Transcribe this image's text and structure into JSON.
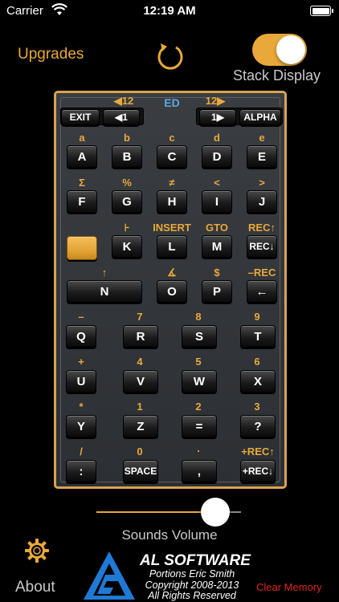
{
  "status": {
    "carrier": "Carrier",
    "time": "12:19 AM"
  },
  "top": {
    "upgrades": "Upgrades",
    "stack_display": "Stack Display",
    "stack_display_on": true
  },
  "calc": {
    "row0": {
      "left_arrow_label": "◀12",
      "ed_label": "ED",
      "right_arrow_label": "12▶",
      "exit": "EXIT",
      "back1": "◀1",
      "fwd1": "1▶",
      "alpha": "ALPHA"
    },
    "rows": [
      {
        "labels": [
          "a",
          "b",
          "c",
          "d",
          "e"
        ],
        "keys": [
          "A",
          "B",
          "C",
          "D",
          "E"
        ]
      },
      {
        "labels": [
          "Σ",
          "%",
          "≠",
          "<",
          ">"
        ],
        "keys": [
          "F",
          "G",
          "H",
          "I",
          "J"
        ]
      },
      {
        "labels": [
          "",
          "⊦",
          "INSERT",
          "GTO",
          "REC↑"
        ],
        "keys": [
          "",
          "K",
          "L",
          "M",
          "REC↓"
        ]
      },
      {
        "labels": [
          "↑",
          "",
          "∡",
          "$",
          "–REC"
        ],
        "keys": [
          "N",
          "",
          "O",
          "P",
          "←"
        ]
      },
      {
        "labels": [
          "–",
          "7",
          "8",
          "9"
        ],
        "keys": [
          "Q",
          "R",
          "S",
          "T"
        ]
      },
      {
        "labels": [
          "+",
          "4",
          "5",
          "6"
        ],
        "keys": [
          "U",
          "V",
          "W",
          "X"
        ]
      },
      {
        "labels": [
          "*",
          "1",
          "2",
          "3"
        ],
        "keys": [
          "Y",
          "Z",
          "=",
          "?"
        ]
      },
      {
        "labels": [
          "/",
          "0",
          ".",
          "+REC↑"
        ],
        "keys": [
          ":",
          "SPACE",
          ",",
          "+REC↓"
        ]
      }
    ]
  },
  "sounds": {
    "label": "Sounds Volume",
    "value": 0.9
  },
  "bottom": {
    "about": "About",
    "company": "AL SOFTWARE",
    "credit1": "Portions Eric Smith",
    "credit2": "Copyright 2008-2013",
    "credit3": "All Rights Reserved",
    "clear_memory": "Clear Memory"
  },
  "colors": {
    "accent": "#e9a93a",
    "clear": "#e0261c",
    "ed": "#5aa8e6"
  },
  "icons": {
    "wifi": "wifi-icon",
    "battery": "battery-icon",
    "refresh": "refresh-icon",
    "gear": "gear-icon",
    "logo": "al-software-logo"
  }
}
